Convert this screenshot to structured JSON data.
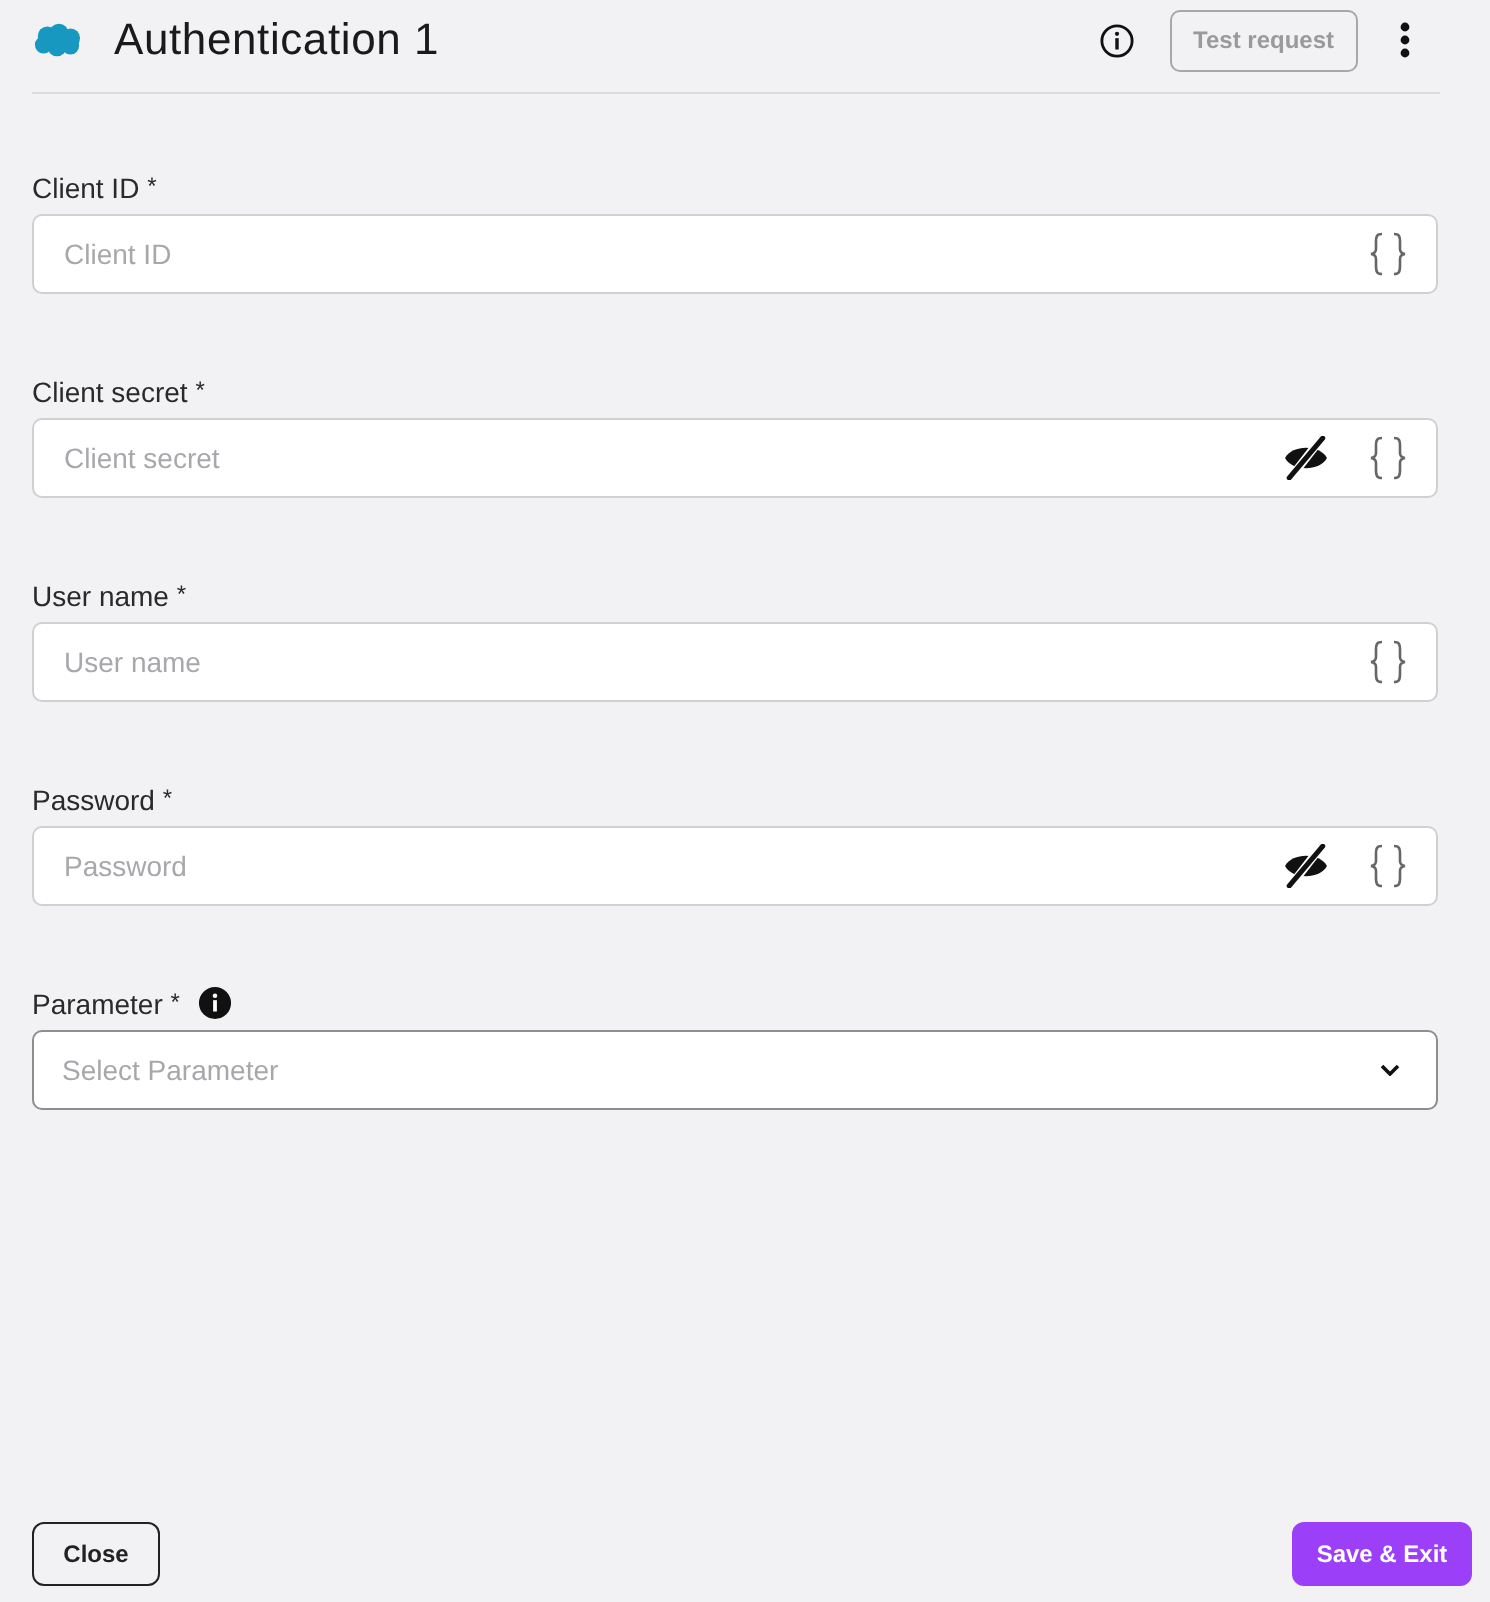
{
  "header": {
    "title": "Authentication 1",
    "test_button": {
      "label": "Test request",
      "disabled": true
    }
  },
  "fields": [
    {
      "kind": "text",
      "label": "Client ID",
      "required_mark": "*",
      "info": false,
      "placeholder": "Client ID"
    },
    {
      "kind": "secret",
      "label": "Client secret",
      "required_mark": "*",
      "info": false,
      "placeholder": "Client secret"
    },
    {
      "kind": "text",
      "label": "User name",
      "required_mark": "*",
      "info": false,
      "placeholder": "User name"
    },
    {
      "kind": "secret",
      "label": "Password",
      "required_mark": "*",
      "info": false,
      "placeholder": "Password"
    },
    {
      "kind": "select",
      "label": "Parameter",
      "required_mark": "*",
      "info": true,
      "placeholder": "Select Parameter"
    }
  ],
  "footer": {
    "buttons": [
      {
        "kind": "secondary",
        "label": "Close"
      },
      {
        "kind": "primary",
        "label": "Save & Exit"
      }
    ]
  }
}
